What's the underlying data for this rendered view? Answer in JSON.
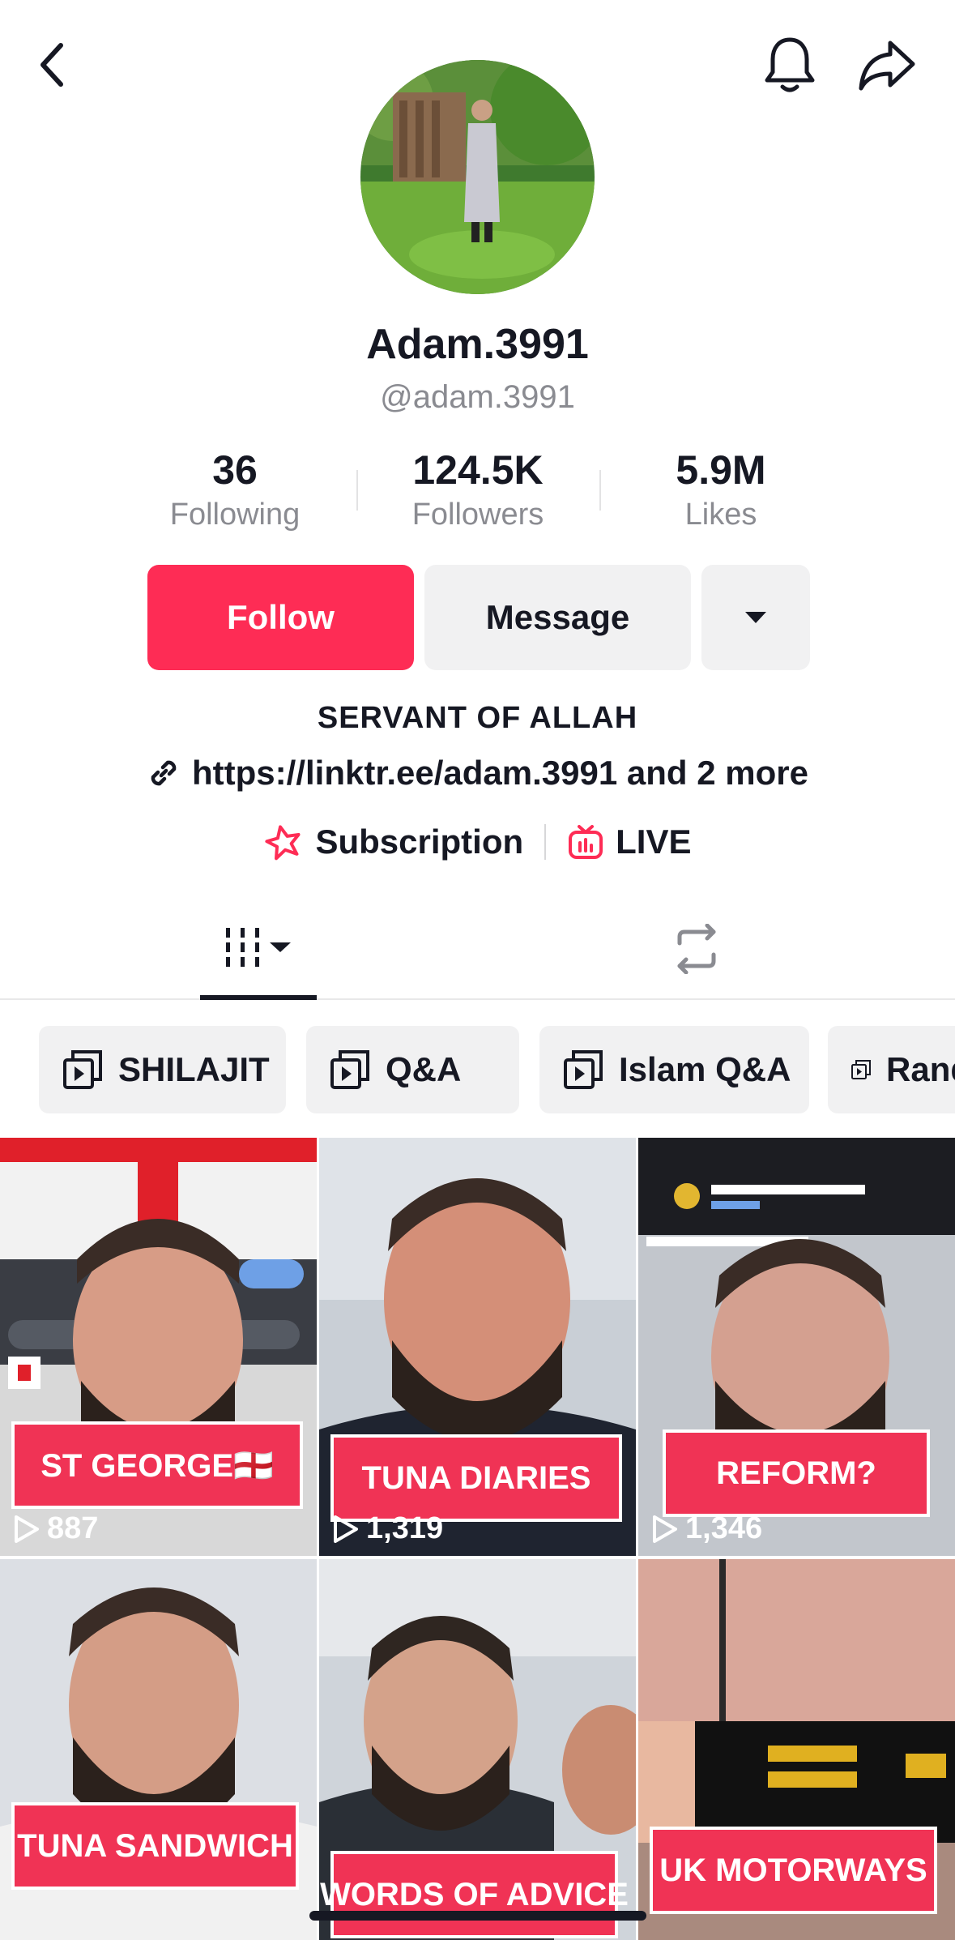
{
  "profile": {
    "display_name": "Adam.3991",
    "handle": "@adam.3991",
    "bio": "SERVANT OF ALLAH",
    "link": "https://linktr.ee/adam.3991 and 2 more"
  },
  "stats": [
    {
      "value": "36",
      "label": "Following"
    },
    {
      "value": "124.5K",
      "label": "Followers"
    },
    {
      "value": "5.9M",
      "label": "Likes"
    }
  ],
  "actions": {
    "follow_label": "Follow",
    "message_label": "Message"
  },
  "extras": {
    "subscription_label": "Subscription",
    "live_label": "LIVE"
  },
  "playlists": [
    {
      "label": "SHILAJIT"
    },
    {
      "label": "Q&A"
    },
    {
      "label": "Islam Q&A"
    },
    {
      "label": "Random"
    }
  ],
  "videos": [
    {
      "caption": "ST GEORGE🏴󠁧󠁢󠁥󠁮󠁧󠁿",
      "views": "887"
    },
    {
      "caption": "TUNA DIARIES",
      "views": "1,319"
    },
    {
      "caption": "REFORM?",
      "views": "1,346"
    },
    {
      "caption": "TUNA SANDWICH",
      "views": ""
    },
    {
      "caption": "WORDS OF ADVICE",
      "views": ""
    },
    {
      "caption": "UK MOTORWAYS",
      "views": ""
    }
  ],
  "colors": {
    "accent": "#fe2c55",
    "text": "#161823",
    "secondary_text": "#8a8b91",
    "chip_bg": "#f1f1f2"
  },
  "icons": [
    "back-icon",
    "bell-icon",
    "share-icon",
    "chevron-down-icon",
    "link-icon",
    "subscription-icon",
    "live-icon",
    "grid-icon",
    "repost-icon",
    "playlist-icon",
    "play-icon"
  ]
}
